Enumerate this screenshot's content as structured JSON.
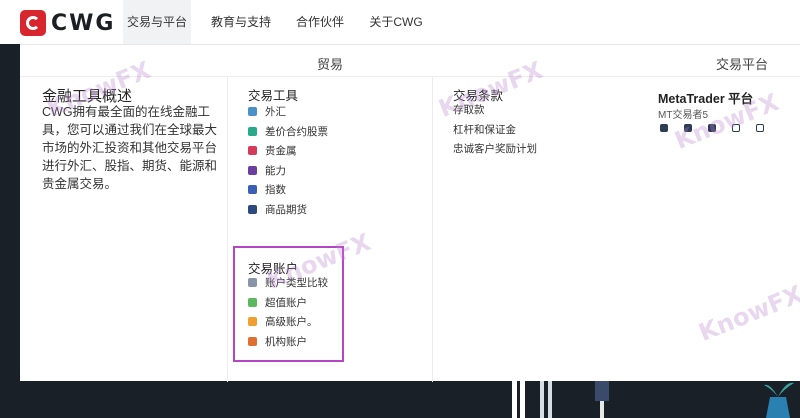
{
  "logo": {
    "text": "CWG"
  },
  "nav": [
    {
      "label": "交易与平台",
      "active": true
    },
    {
      "label": "教育与支持"
    },
    {
      "label": "合作伙伴"
    },
    {
      "label": "关于CWG"
    }
  ],
  "panel": {
    "header_left": "贸易",
    "header_right": "交易平台",
    "overview": {
      "title": "金融工具概述",
      "description": "CWG拥有最全面的在线金融工具，您可以通过我们在全球最大市场的外汇投资和其他交易平台进行外汇、股指、期货、能源和贵金属交易。"
    },
    "trading_tools": {
      "title": "交易工具",
      "items": [
        {
          "label": "外汇",
          "icon": "forex-icon",
          "color": "#4a90c9"
        },
        {
          "label": "差价合约股票",
          "icon": "cfd-stocks-icon",
          "color": "#2aa88a"
        },
        {
          "label": "贵金属",
          "icon": "precious-metals-icon",
          "color": "#d63a5a"
        },
        {
          "label": "能力",
          "icon": "energy-icon",
          "color": "#6b3fa0"
        },
        {
          "label": "指数",
          "icon": "index-icon",
          "color": "#3b5fb5"
        },
        {
          "label": "商品期货",
          "icon": "commodity-futures-icon",
          "color": "#2d4a80"
        }
      ]
    },
    "trading_accounts": {
      "title": "交易账户",
      "items": [
        {
          "label": "账户类型比较",
          "icon": "compare-icon",
          "color": "#8a94a8"
        },
        {
          "label": "超值账户",
          "icon": "value-account-icon",
          "color": "#5cb85c"
        },
        {
          "label": "高级账户。",
          "icon": "premium-account-icon",
          "color": "#f0a030"
        },
        {
          "label": "机构账户",
          "icon": "institutional-account-icon",
          "color": "#e07030"
        }
      ]
    },
    "trading_terms": {
      "title": "交易条款",
      "items": [
        {
          "label": "存取款"
        },
        {
          "label": "杠杆和保证金"
        },
        {
          "label": "忠诚客户奖励计划"
        }
      ]
    },
    "platform": {
      "title": "MetaTrader 平台",
      "subtitle": "MT交易者5"
    }
  },
  "watermarks": [
    "KnowFX",
    "KnowFX",
    "KnowFX",
    "KnowFX",
    "KnowFX"
  ]
}
